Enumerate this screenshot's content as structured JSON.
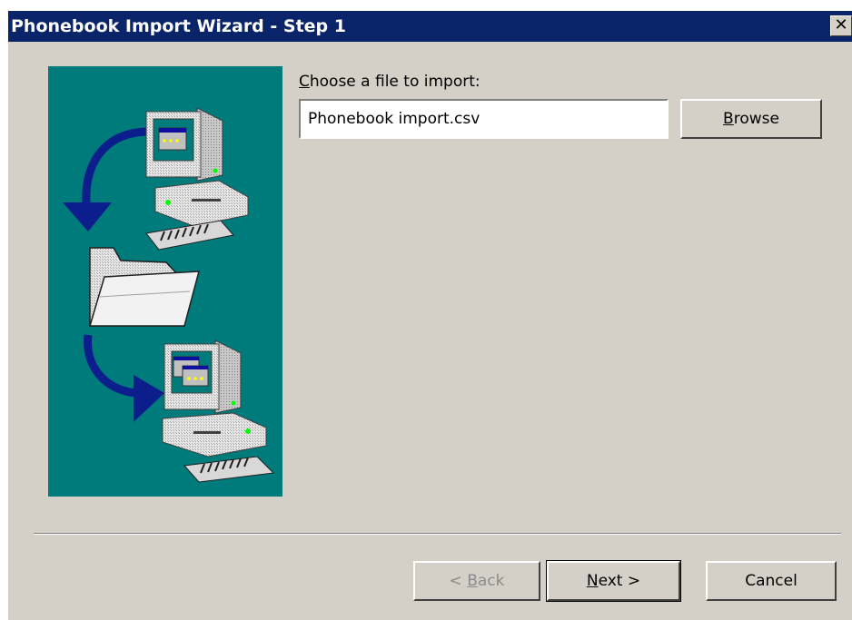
{
  "window": {
    "title": "Phonebook Import Wizard - Step 1",
    "close_glyph": "✕"
  },
  "file_section": {
    "label_mnemonic": "C",
    "label_rest": "hoose a file to import:",
    "input_value": "Phonebook import.csv",
    "browse_mnemonic": "B",
    "browse_rest": "rowse"
  },
  "buttons": {
    "back_prefix": "< ",
    "back_mnemonic": "B",
    "back_rest": "ack",
    "next_mnemonic": "N",
    "next_rest": "ext >",
    "cancel": "Cancel"
  },
  "colors": {
    "titlebar": "#0a246a",
    "dialog_face": "#d4d0c8",
    "illustration_background": "#007b7b",
    "arrow": "#0c1d8c"
  },
  "icons": [
    "close-icon",
    "computer-icon",
    "folder-icon",
    "arrow-icon"
  ]
}
